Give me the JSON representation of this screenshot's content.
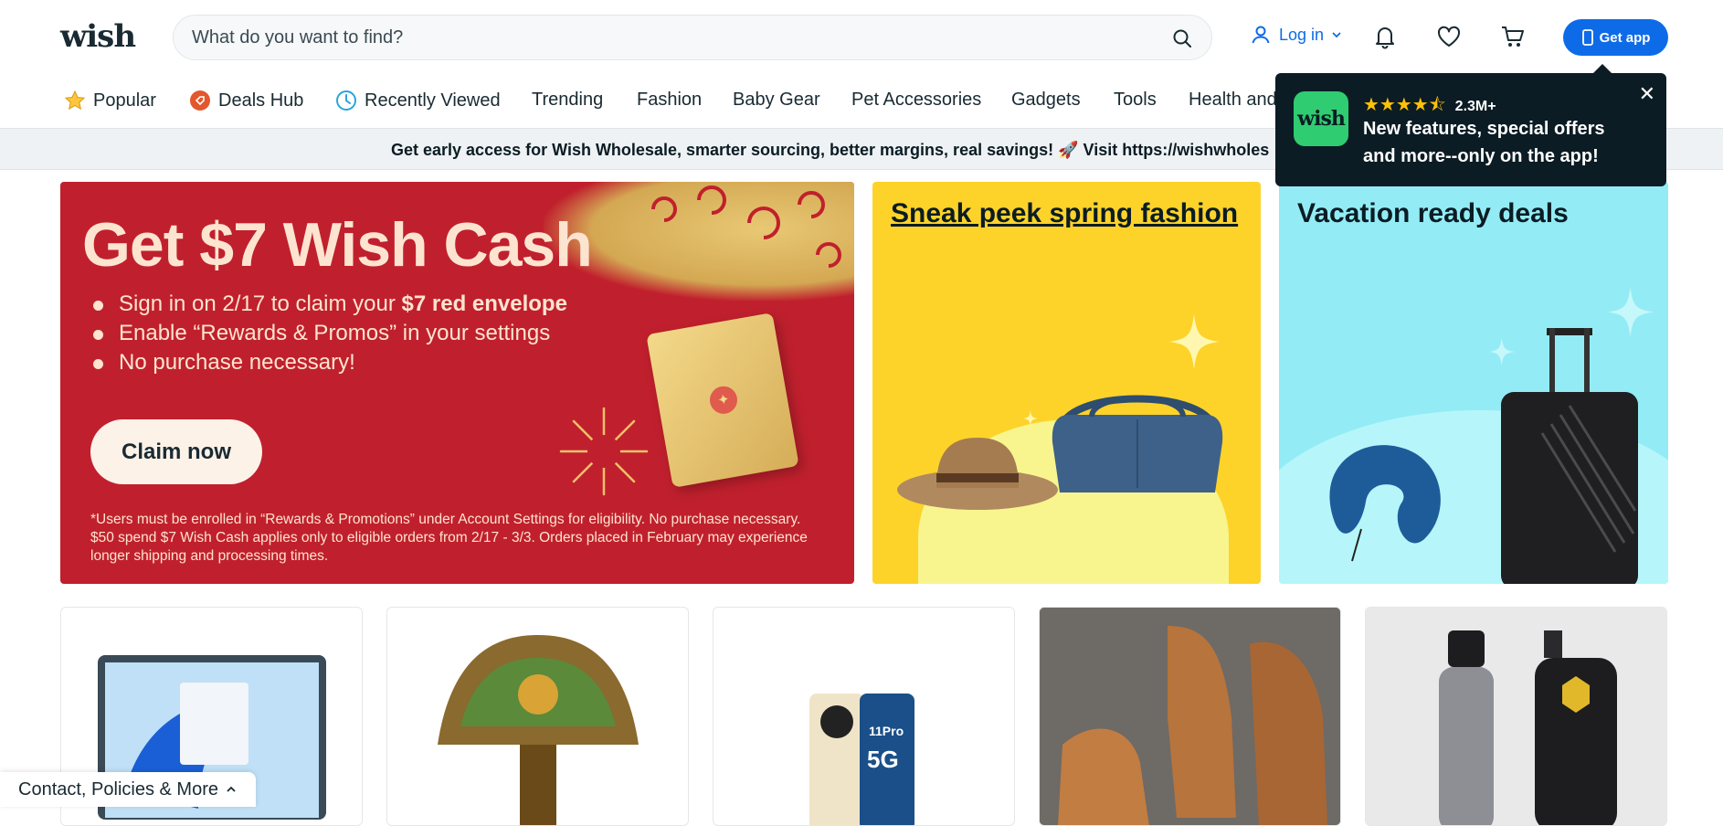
{
  "header": {
    "logo": "wish",
    "search_placeholder": "What do you want to find?",
    "login_label": "Log in",
    "get_app_label": "Get app"
  },
  "nav": {
    "items": [
      {
        "label": "Popular",
        "icon": "star-icon"
      },
      {
        "label": "Deals Hub",
        "icon": "deals-tag-icon"
      },
      {
        "label": "Recently Viewed",
        "icon": "clock-icon"
      },
      {
        "label": "Trending"
      },
      {
        "label": "Fashion"
      },
      {
        "label": "Baby Gear"
      },
      {
        "label": "Pet Accessories"
      },
      {
        "label": "Gadgets"
      },
      {
        "label": "Tools"
      },
      {
        "label": "Health and"
      }
    ]
  },
  "announcement": {
    "text": "Get early access for Wish Wholesale, smarter sourcing, better margins, real savings! 🚀 Visit https://wishwholes"
  },
  "popup": {
    "logo": "wish",
    "stars": "★★★★⯪",
    "count": "2.3M+",
    "text": "New features, special offers and more--only on the app!",
    "close": "✕"
  },
  "promo_red": {
    "title": "Get $7 Wish Cash",
    "bullet_1_pre": "Sign in on 2/17 to claim your ",
    "bullet_1_bold": "$7 red envelope",
    "bullet_2": "Enable “Rewards & Promos” in your settings",
    "bullet_3": "No purchase necessary!",
    "button": "Claim now",
    "fine_print": "*Users must be enrolled in “Rewards & Promotions” under Account Settings for eligibility. No purchase necessary. $50 spend $7 Wish Cash applies only to eligible orders from 2/17 - 3/3. Orders placed in February may experience longer shipping and processing times."
  },
  "promo_yellow": {
    "title": "Sneak peek spring fashion"
  },
  "promo_cyan": {
    "title": "Vacation ready deals"
  },
  "footer": {
    "link": "Contact, Policies & More"
  },
  "colors": {
    "brand_blue": "#0e6be8",
    "promo_red": "#c0202d",
    "promo_yellow": "#fdd32a",
    "promo_cyan": "#93ecf5",
    "popup_bg": "#0b1c24",
    "wish_green": "#2fcc71"
  }
}
